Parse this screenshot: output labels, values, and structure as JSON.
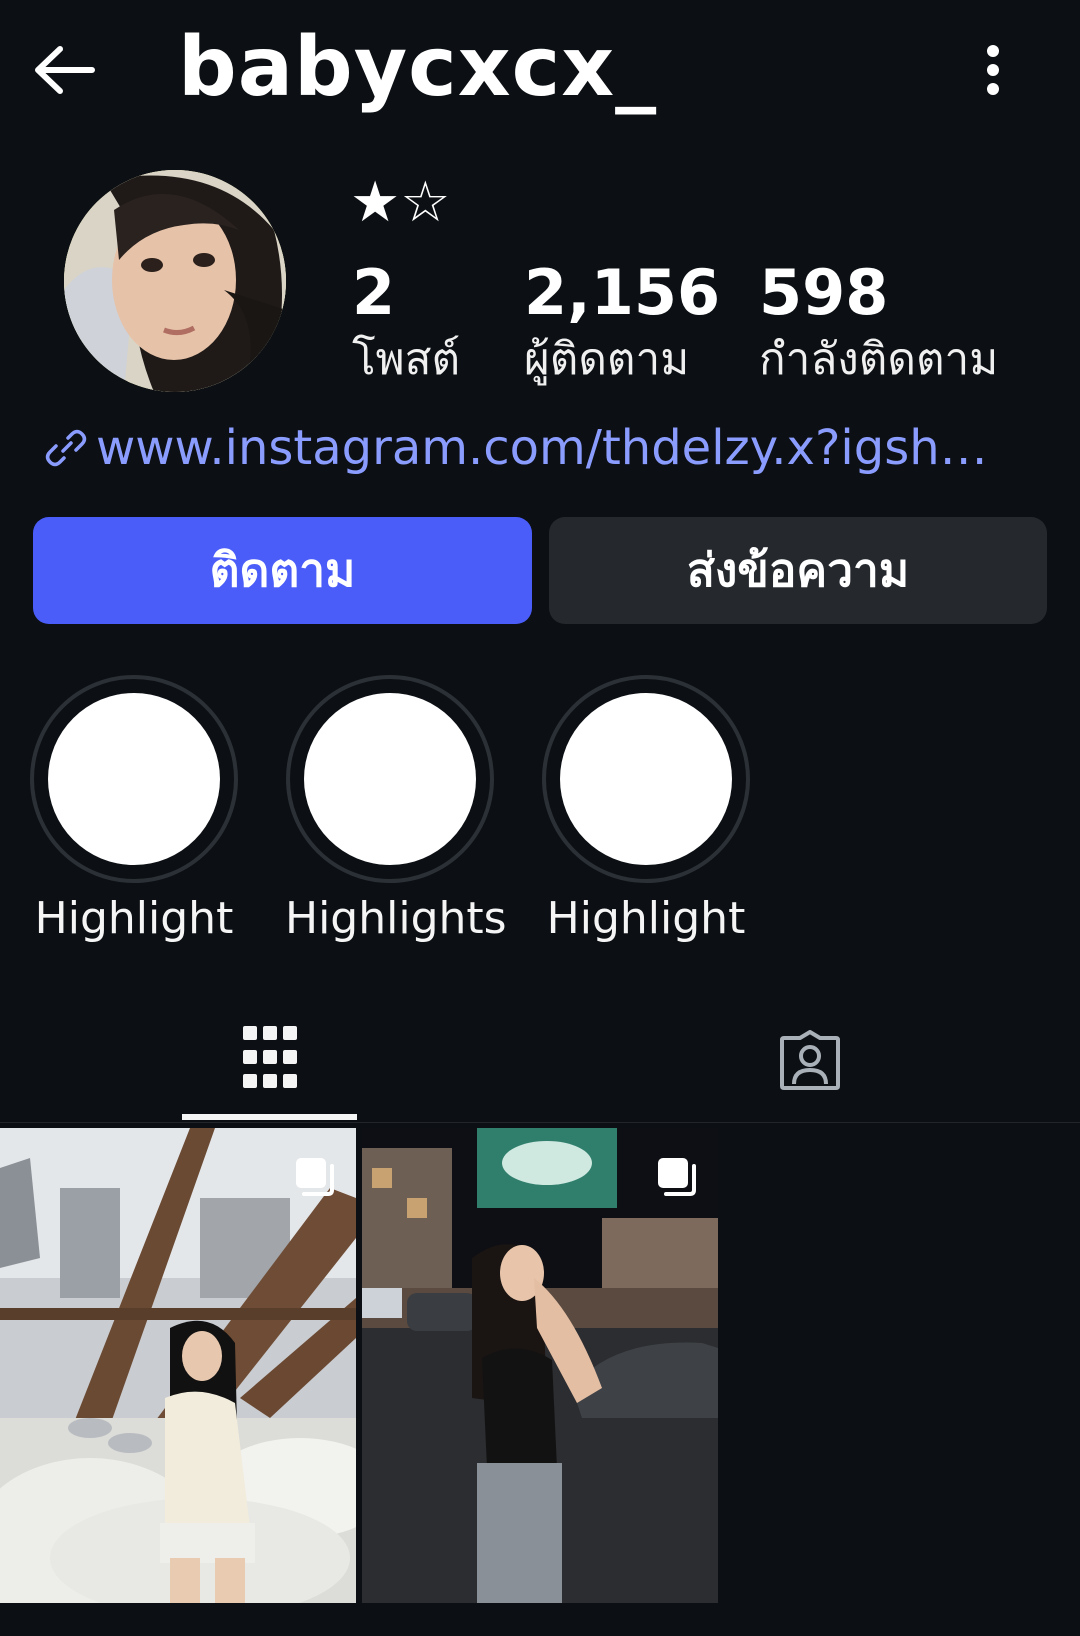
{
  "header": {
    "username": "babycxcx_",
    "back_icon": "arrow-left-icon",
    "more_icon": "more-vertical-icon"
  },
  "profile": {
    "display_name": "★☆",
    "stats": [
      {
        "value": "2",
        "label": "โพสต์"
      },
      {
        "value": "2,156",
        "label": "ผู้ติดตาม"
      },
      {
        "value": "598",
        "label": "กำลังติดตาม"
      }
    ],
    "link": "www.instagram.com/thdelzy.x?igsh…",
    "link_color": "#8b9cff"
  },
  "actions": {
    "follow_label": "ติดตาม",
    "message_label": "ส่งข้อความ",
    "follow_color": "#4a5df9",
    "message_color": "#25292e"
  },
  "highlights": [
    {
      "label": "Highlight"
    },
    {
      "label": "Highlights"
    },
    {
      "label": "Highlight"
    }
  ],
  "tabs": [
    {
      "icon": "grid-icon",
      "active": true
    },
    {
      "icon": "tagged-person-icon",
      "active": false
    }
  ],
  "posts": [
    {
      "type": "carousel",
      "icon": "multiple-posts-icon"
    },
    {
      "type": "carousel",
      "icon": "multiple-posts-icon"
    }
  ]
}
